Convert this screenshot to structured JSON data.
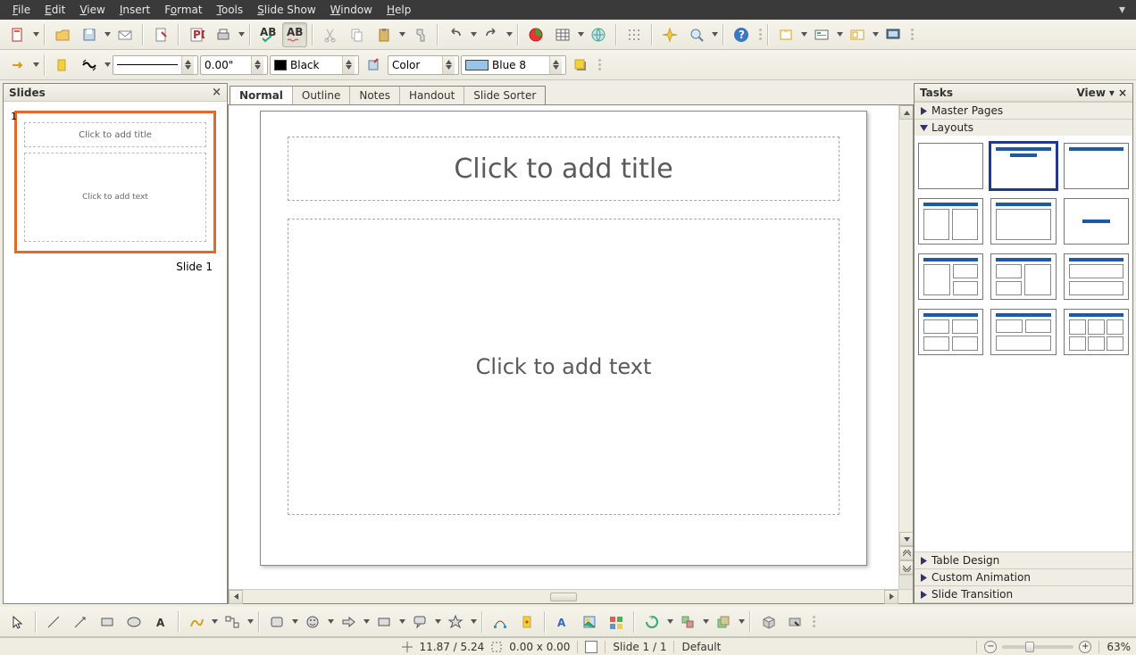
{
  "menu": {
    "file": "File",
    "edit": "Edit",
    "view": "View",
    "insert": "Insert",
    "format": "Format",
    "tools": "Tools",
    "slideshow": "Slide Show",
    "window": "Window",
    "help": "Help"
  },
  "linewidth": "0.00\"",
  "linecolor": {
    "label": "Black",
    "hex": "#000000"
  },
  "areacolor": {
    "label": "Color"
  },
  "fillcolor": {
    "label": "Blue 8",
    "hex": "#99c4e6"
  },
  "slides": {
    "title": "Slides",
    "thumb_title": "Click to add title",
    "thumb_text": "Click to add text",
    "label": "Slide 1"
  },
  "viewtabs": [
    "Normal",
    "Outline",
    "Notes",
    "Handout",
    "Slide Sorter"
  ],
  "slide": {
    "title_ph": "Click to add title",
    "text_ph": "Click to add text"
  },
  "tasks": {
    "title": "Tasks",
    "view": "View",
    "sections": {
      "master": "Master Pages",
      "layouts": "Layouts",
      "table": "Table Design",
      "anim": "Custom Animation",
      "trans": "Slide Transition"
    }
  },
  "status": {
    "pos": "11.87 / 5.24",
    "size": "0.00 x 0.00",
    "slide": "Slide 1 / 1",
    "style": "Default",
    "zoom": "63%"
  }
}
